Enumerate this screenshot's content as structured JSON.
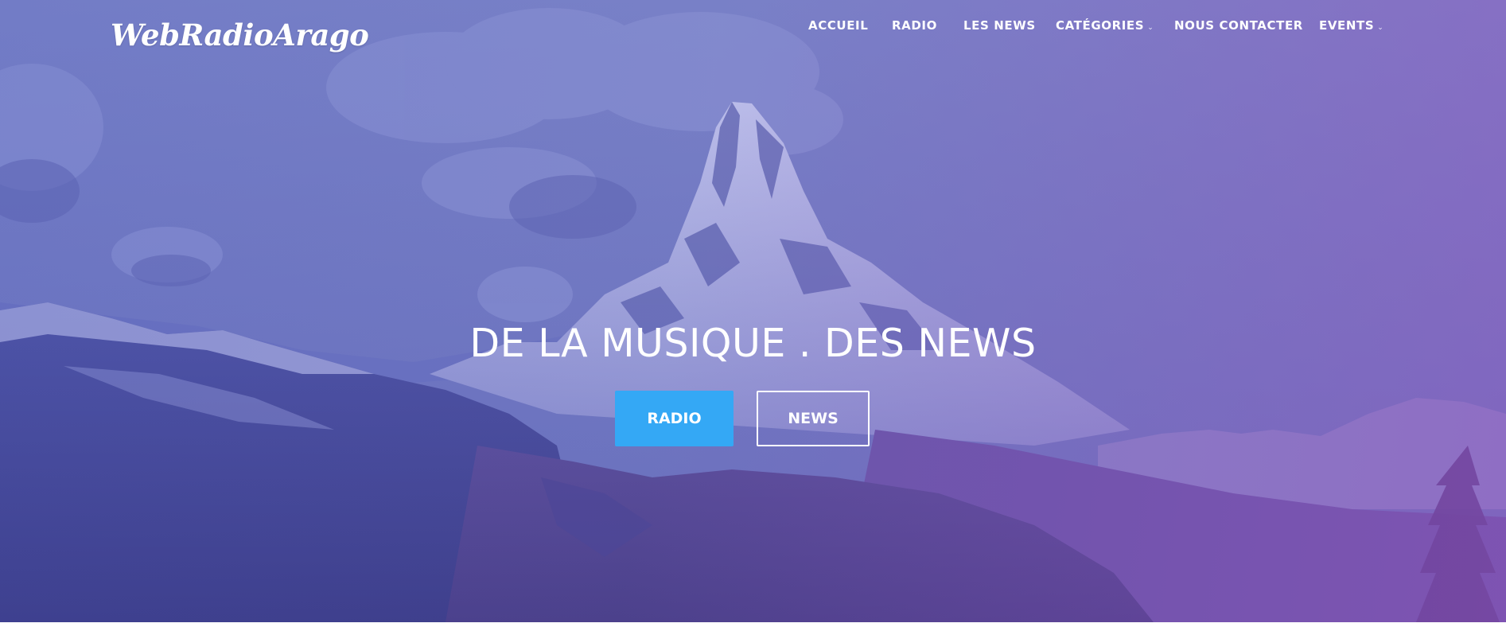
{
  "site": {
    "logo_text": "WebRadioArago"
  },
  "nav": {
    "items": [
      {
        "label": "ACCUEIL",
        "has_dropdown": false
      },
      {
        "label": "RADIO",
        "has_dropdown": false
      },
      {
        "label": "LES NEWS",
        "has_dropdown": false
      },
      {
        "label": "CATÉGORIES",
        "has_dropdown": true
      },
      {
        "label": "NOUS CONTACTER",
        "has_dropdown": false
      },
      {
        "label": "EVENTS",
        "has_dropdown": true
      }
    ],
    "dropdown_icon": "chevron-down-icon"
  },
  "hero": {
    "headline": "DE LA MUSIQUE . DES NEWS",
    "primary_button": "RADIO",
    "secondary_button": "NEWS",
    "background": "mountain-landscape"
  },
  "colors": {
    "primary_button": "#34a8f5",
    "text": "#ffffff",
    "overlay_left": "#4e58b0",
    "overlay_right": "#9a60b8"
  }
}
